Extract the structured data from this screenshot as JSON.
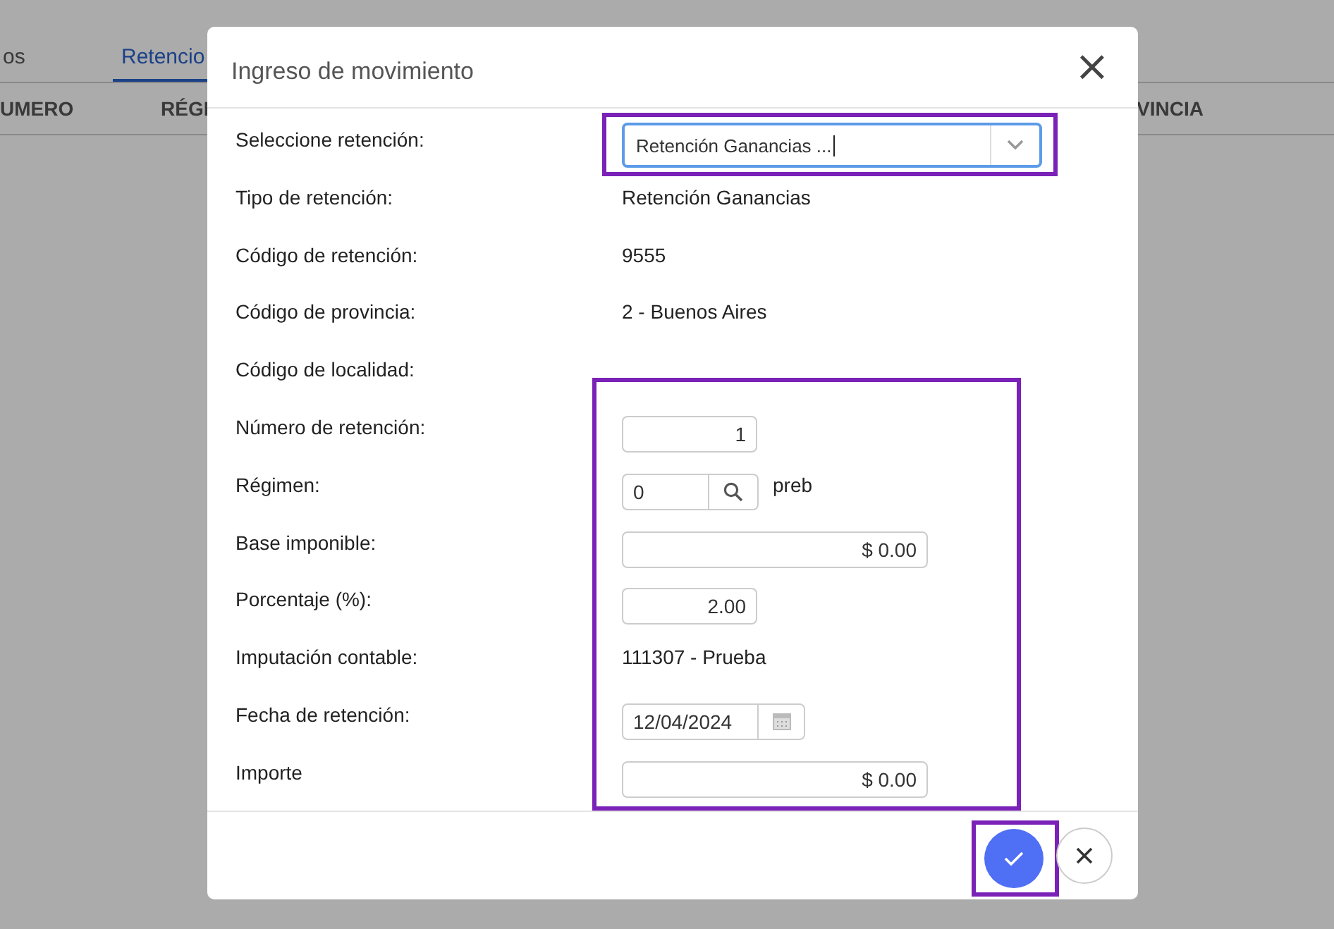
{
  "background": {
    "tabs": [
      {
        "label": "os",
        "selected": false
      },
      {
        "label": "Retencio",
        "selected": true
      }
    ],
    "columns": [
      "UMERO",
      "RÉGI",
      "VINCIA"
    ]
  },
  "dialog": {
    "title": "Ingreso de movimiento",
    "close": "×",
    "rows": [
      {
        "kind": "select",
        "label": "Seleccione retención:",
        "value": "Retención Ganancias ...",
        "highlighted": true
      },
      {
        "kind": "text",
        "label": "Tipo de retención:",
        "value": "Retención Ganancias"
      },
      {
        "kind": "text",
        "label": "Código de retención:",
        "value": "9555"
      },
      {
        "kind": "text",
        "label": "Código de provincia:",
        "value": "2 - Buenos Aires"
      },
      {
        "kind": "text",
        "label": "Código de localidad:"
      },
      {
        "kind": "input",
        "label": "Número de retención:",
        "value": "1"
      },
      {
        "kind": "lookup",
        "label": "Régimen:",
        "value": "0",
        "note": "preb"
      },
      {
        "kind": "wide_input",
        "label": "Base imponible:",
        "value": "$ 0.00"
      },
      {
        "kind": "input",
        "label": "Porcentaje (%):",
        "value": "2.00"
      },
      {
        "kind": "text",
        "label": "Imputación contable:",
        "value": "111307 - Prueba"
      },
      {
        "kind": "date",
        "label": "Fecha de retención:",
        "value": "12/04/2024"
      },
      {
        "kind": "wide_input",
        "label": "Importe",
        "value": "$ 0.00"
      }
    ],
    "group_highlighted": true,
    "buttons": [
      {
        "kind": "confirm",
        "highlighted": true
      },
      {
        "kind": "cancel",
        "highlighted": false
      }
    ]
  }
}
